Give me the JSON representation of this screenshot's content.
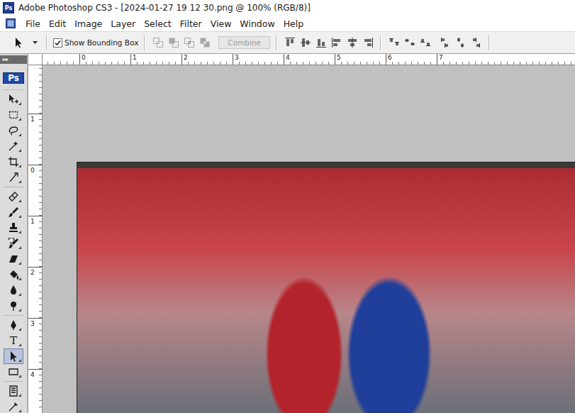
{
  "window": {
    "title": "Adobe Photoshop CS3 - [2024-01-27 19 12 30.png @ 100% (RGB/8)]",
    "app_badge": "Ps"
  },
  "menu": {
    "items": [
      "File",
      "Edit",
      "Image",
      "Layer",
      "Select",
      "Filter",
      "View",
      "Window",
      "Help"
    ]
  },
  "options_bar": {
    "tool_kind": "path-select",
    "show_bounding_box": {
      "label": "Show Bounding Box",
      "checked": true
    },
    "path_modes": [
      {
        "kind": "mode-add",
        "disabled": true
      },
      {
        "kind": "mode-subtract",
        "disabled": true
      },
      {
        "kind": "mode-intersect",
        "disabled": true
      },
      {
        "kind": "mode-exclude",
        "disabled": true
      }
    ],
    "combine": {
      "label": "Combine",
      "disabled": true
    },
    "align": [
      {
        "kind": "align-top"
      },
      {
        "kind": "align-vcenter"
      },
      {
        "kind": "align-bottom"
      },
      {
        "kind": "align-left"
      },
      {
        "kind": "align-hcenter"
      },
      {
        "kind": "align-right"
      }
    ],
    "distribute": [
      {
        "kind": "dist-top"
      },
      {
        "kind": "dist-vcenter"
      },
      {
        "kind": "dist-bottom"
      },
      {
        "kind": "dist-left"
      },
      {
        "kind": "dist-hcenter"
      },
      {
        "kind": "dist-right"
      }
    ]
  },
  "toolbox": {
    "collapse": "▸▸",
    "logo": "Ps",
    "groups": [
      [
        {
          "kind": "move",
          "selected": false
        },
        {
          "kind": "marquee",
          "selected": false
        },
        {
          "kind": "lasso",
          "selected": false
        },
        {
          "kind": "wand",
          "selected": false
        },
        {
          "kind": "crop",
          "selected": false
        },
        {
          "kind": "slice",
          "selected": false
        }
      ],
      [
        {
          "kind": "heal",
          "selected": false
        },
        {
          "kind": "brush",
          "selected": false
        },
        {
          "kind": "stamp",
          "selected": false
        },
        {
          "kind": "history",
          "selected": false
        },
        {
          "kind": "eraser",
          "selected": false
        },
        {
          "kind": "bucket",
          "selected": false
        },
        {
          "kind": "blur",
          "selected": false
        },
        {
          "kind": "dodge",
          "selected": false
        }
      ],
      [
        {
          "kind": "pen",
          "selected": false
        },
        {
          "kind": "type",
          "label": "T",
          "selected": false
        },
        {
          "kind": "path-select",
          "selected": true
        },
        {
          "kind": "shape",
          "selected": false
        }
      ],
      [
        {
          "kind": "notes",
          "selected": false
        },
        {
          "kind": "eyedropper",
          "selected": false
        }
      ]
    ]
  },
  "rulers": {
    "horizontal": [
      "0",
      "1",
      "2",
      "3",
      "4",
      "5",
      "6",
      "7"
    ],
    "vertical": [
      "1",
      "0",
      "1",
      "2",
      "3",
      "4"
    ]
  }
}
